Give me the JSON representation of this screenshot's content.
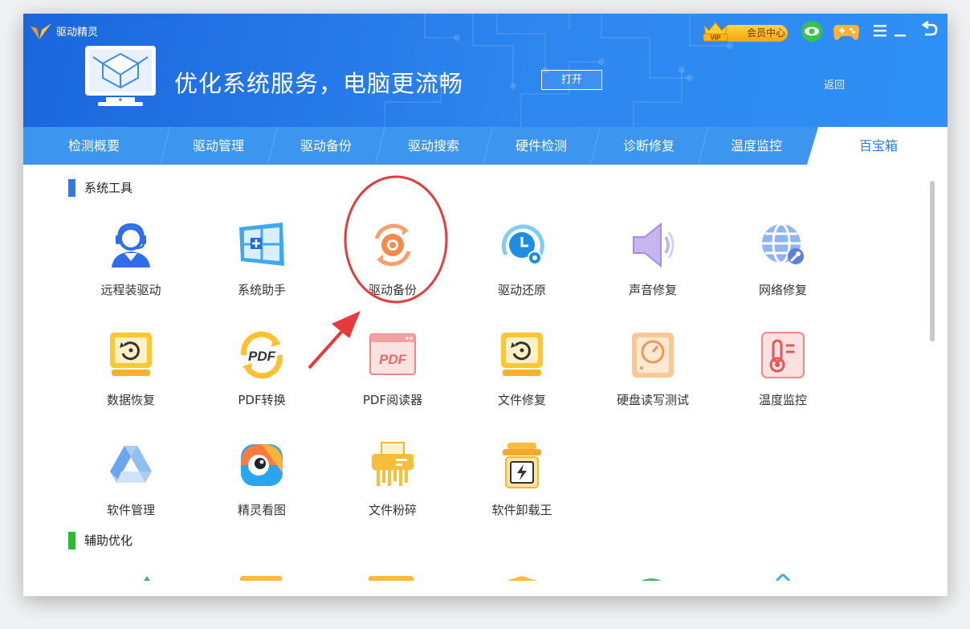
{
  "app": {
    "name": "驱动精灵",
    "logo_icon": "v-wing-logo-icon"
  },
  "banner": {
    "title": "优化系统服务，电脑更流畅",
    "open_button": "打开",
    "back_link": "返回"
  },
  "window_controls": {
    "vip_label": "会员中心",
    "vip_badge_icon": "vip-crown-icon",
    "eye_icon": "eye-protect-icon",
    "game_icon": "gamepad-icon",
    "menu_icon": "menu-icon",
    "minimize_icon": "minimize-icon",
    "back_icon": "back-arrow-icon"
  },
  "nav": {
    "tabs": [
      "检测概要",
      "驱动管理",
      "驱动备份",
      "驱动搜索",
      "硬件检测",
      "诊断修复",
      "温度监控",
      "百宝箱"
    ],
    "active_index": 7
  },
  "sections": [
    {
      "title": "系统工具",
      "bar_color": "#2f7be6",
      "tools": [
        {
          "label": "远程装驱动",
          "icon": "headset-support-icon"
        },
        {
          "label": "系统助手",
          "icon": "windows-add-icon"
        },
        {
          "label": "驱动备份",
          "icon": "gear-backup-icon"
        },
        {
          "label": "驱动还原",
          "icon": "clock-restore-icon"
        },
        {
          "label": "声音修复",
          "icon": "speaker-icon"
        },
        {
          "label": "网络修复",
          "icon": "globe-repair-icon"
        },
        {
          "label": "数据恢复",
          "icon": "monitor-restore-icon"
        },
        {
          "label": "PDF转换",
          "icon": "pdf-convert-icon"
        },
        {
          "label": "PDF阅读器",
          "icon": "pdf-reader-icon"
        },
        {
          "label": "文件修复",
          "icon": "file-repair-icon"
        },
        {
          "label": "硬盘读写测试",
          "icon": "disk-test-icon"
        },
        {
          "label": "温度监控",
          "icon": "thermometer-icon"
        },
        {
          "label": "软件管理",
          "icon": "software-manager-icon"
        },
        {
          "label": "精灵看图",
          "icon": "image-viewer-icon"
        },
        {
          "label": "文件粉碎",
          "icon": "shredder-icon"
        },
        {
          "label": "软件卸载王",
          "icon": "uninstall-icon"
        }
      ]
    },
    {
      "title": "辅助优化",
      "bar_color": "#22c32a",
      "tools": []
    }
  ],
  "pdf_text": "PDF",
  "colors": {
    "header_start": "#1a66dd",
    "header_end": "#2e90f4",
    "nav_bg": "#3c95ef",
    "active_tab_text": "#2f7be6",
    "annotation_red": "#e63b3b"
  }
}
